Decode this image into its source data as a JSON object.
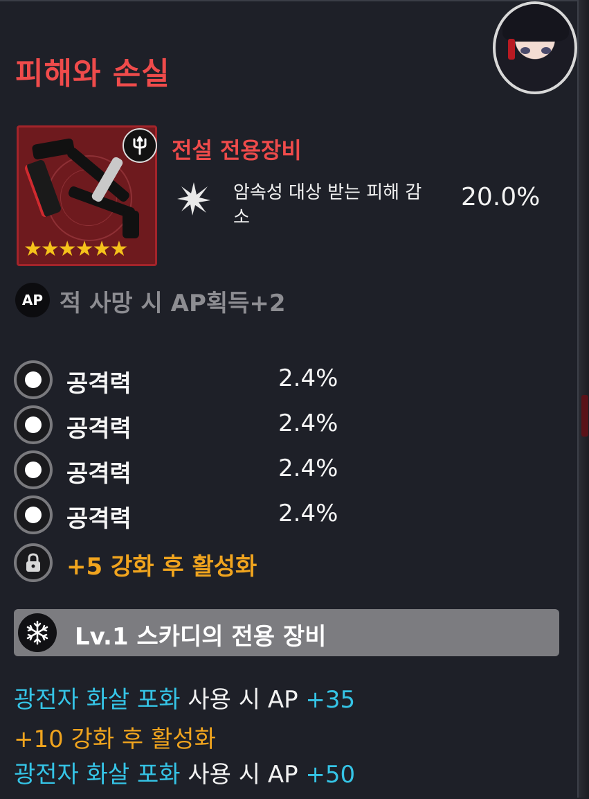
{
  "title": "피해와 손실",
  "item": {
    "tier_label": "전설 전용장비",
    "star_count": 6,
    "stars_text": "★★★★★★",
    "class_icon": "trident-icon",
    "effect": {
      "label": "암속성 대상 받는 피해 감소",
      "value": "20.0%",
      "icon": "spark-icon"
    }
  },
  "ap": {
    "badge": "AP",
    "text": "적 사망 시 AP획득+2"
  },
  "stats": [
    {
      "name": "공격력",
      "value": "2.4%"
    },
    {
      "name": "공격력",
      "value": "2.4%"
    },
    {
      "name": "공격력",
      "value": "2.4%"
    },
    {
      "name": "공격력",
      "value": "2.4%"
    }
  ],
  "locked": {
    "text": "+5 강화 후 활성화",
    "icon": "lock-icon"
  },
  "level_bar": {
    "text": "Lv.1 스카디의 전용 장비",
    "icon": "snowflake-icon"
  },
  "skills": {
    "line1": {
      "skill": "광전자 화살 포화",
      "mid": " 사용 시 AP ",
      "bonus": "+35"
    },
    "unlock_text": "+10 강화 후 활성화",
    "line2": {
      "skill": "광전자 화살 포화",
      "mid": " 사용 시 AP ",
      "bonus": "+50"
    }
  },
  "colors": {
    "title": "#ef4b4b",
    "accent_orange": "#f0a41e",
    "accent_cyan": "#35c4e6",
    "item_bg": "#6e1a1e"
  }
}
